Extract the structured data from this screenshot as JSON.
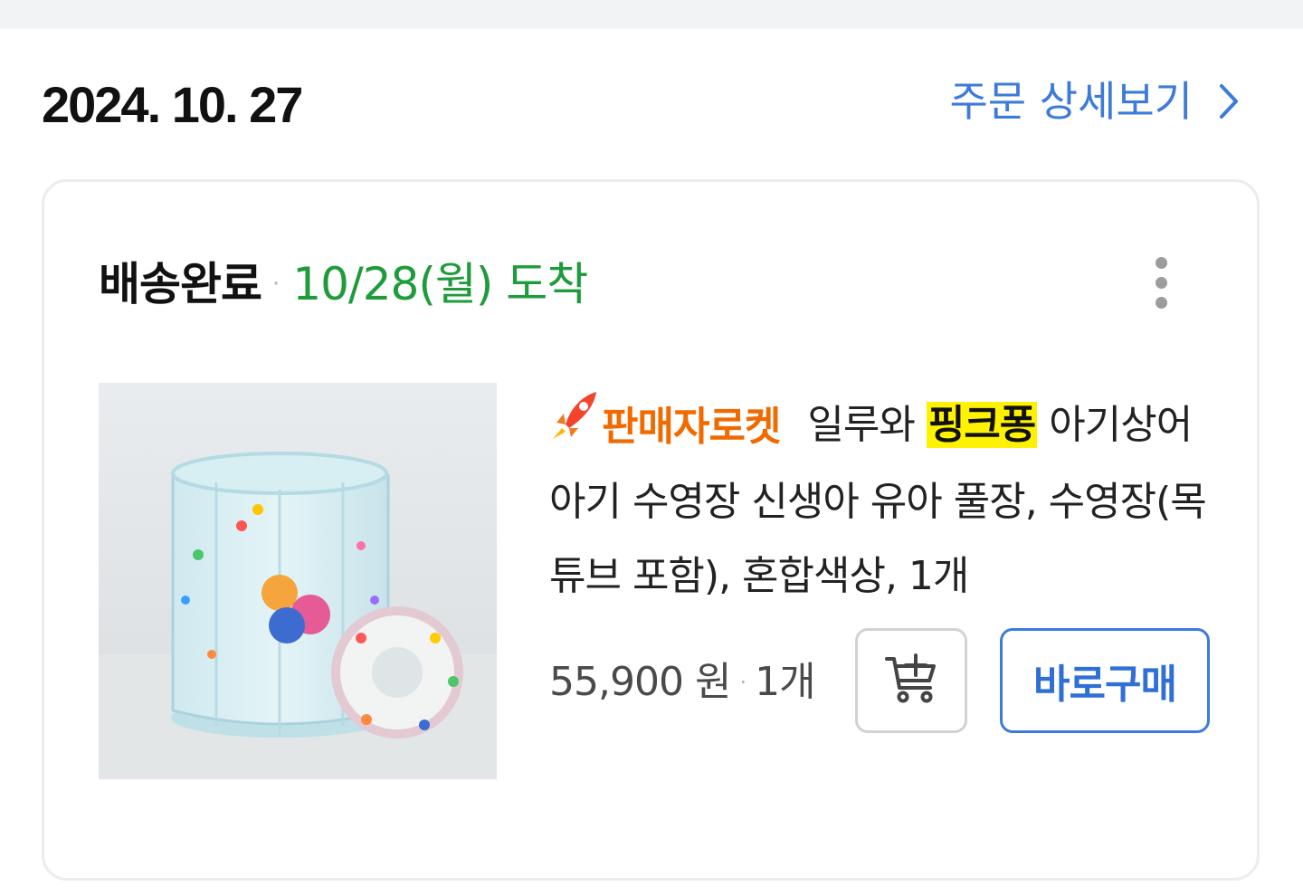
{
  "order": {
    "date": "2024. 10. 27",
    "detail_link": "주문 상세보기"
  },
  "delivery": {
    "status": "배송완료",
    "separator": "·",
    "arrival": "10/28(월) 도착"
  },
  "product": {
    "badge": "판매자로켓",
    "title_before": "일루와 ",
    "title_highlight": "핑크퐁",
    "title_after": " 아기상어 아기 수영장 신생아 유아 풀장, 수영장(목튜브 포함), 혼합색상, 1개",
    "price": "55,900 원",
    "separator": "·",
    "quantity": "1개"
  },
  "actions": {
    "buy_now": "바로구매"
  },
  "icons": {
    "detail_link": "chevron-right-icon",
    "more": "more-vertical-icon",
    "badge": "rocket-icon",
    "cart": "add-to-cart-icon"
  },
  "colors": {
    "link_blue": "#3d7bd9",
    "arrival_green": "#1e9b3a",
    "badge_orange": "#f06a00",
    "highlight_yellow": "#fff200"
  }
}
